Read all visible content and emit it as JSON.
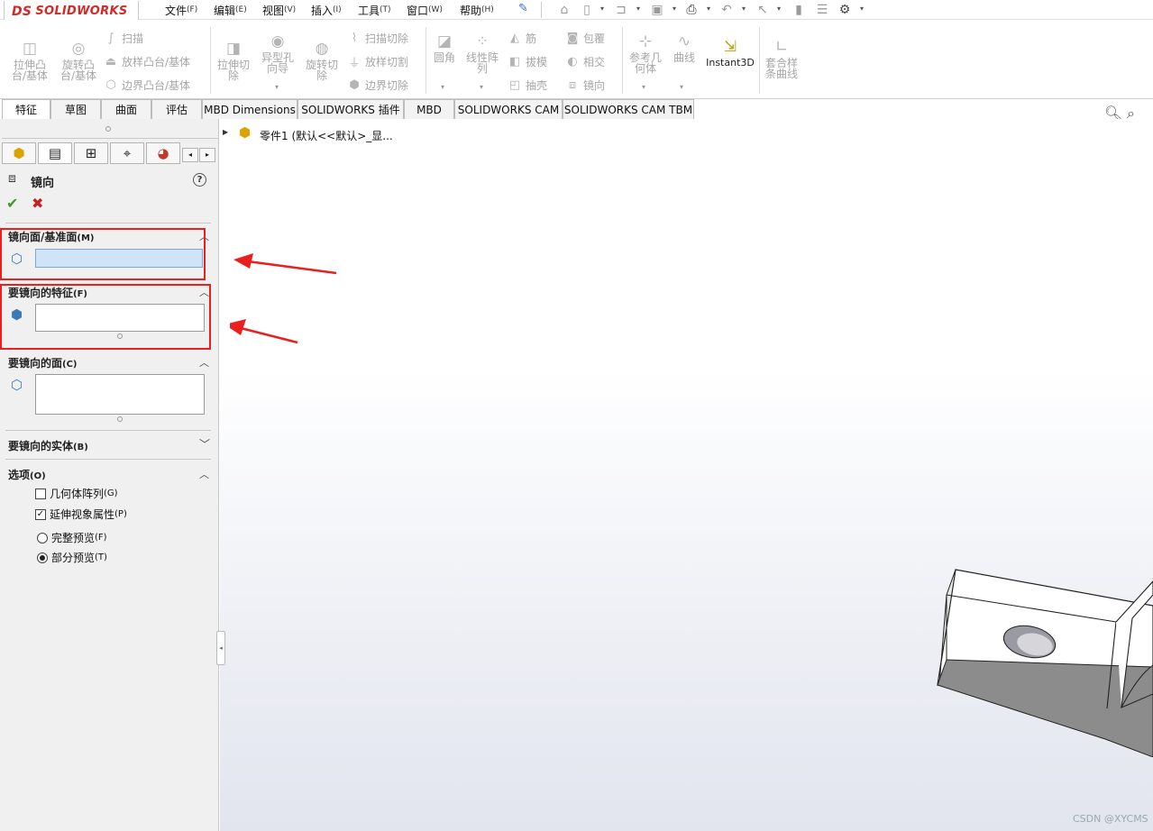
{
  "app": {
    "logo_ds": "DS",
    "logo_text": "SOLIDWORKS"
  },
  "menus": [
    {
      "label": "文件",
      "key": "(F)"
    },
    {
      "label": "编辑",
      "key": "(E)"
    },
    {
      "label": "视图",
      "key": "(V)"
    },
    {
      "label": "插入",
      "key": "(I)"
    },
    {
      "label": "工具",
      "key": "(T)"
    },
    {
      "label": "窗口",
      "key": "(W)"
    },
    {
      "label": "帮助",
      "key": "(H)"
    }
  ],
  "ribbon": {
    "extrude_boss": "拉伸凸\n台/基体",
    "revolve_boss": "旋转凸\n台/基体",
    "sweep": "扫描",
    "loft_boss": "放样凸台/基体",
    "boundary_boss": "边界凸台/基体",
    "extrude_cut": "拉伸切\n除",
    "hole_wizard": "异型孔\n向导",
    "revolve_cut": "旋转切\n除",
    "sweep_cut": "扫描切除",
    "loft_cut": "放样切割",
    "boundary_cut": "边界切除",
    "fillet": "圆角",
    "linear_pattern": "线性阵\n列",
    "rib": "筋",
    "draft": "拔模",
    "shell": "抽壳",
    "wrap": "包覆",
    "intersect": "相交",
    "mirror": "镜向",
    "ref_geometry": "参考几\n何体",
    "curves": "曲线",
    "instant3d": "Instant3D",
    "fit_spline": "套合样\n条曲线"
  },
  "tabs": [
    "特征",
    "草图",
    "曲面",
    "评估",
    "MBD Dimensions",
    "SOLIDWORKS 插件",
    "MBD",
    "SOLIDWORKS CAM",
    "SOLIDWORKS CAM TBM"
  ],
  "feature_tree": {
    "root": "零件1 (默认<<默认>_显..."
  },
  "property_manager": {
    "title": "镜向",
    "help": "?",
    "sections": {
      "mirror_plane": {
        "label": "镜向面/基准面",
        "key": "(M)"
      },
      "features": {
        "label": "要镜向的特征",
        "key": "(F)"
      },
      "faces": {
        "label": "要镜向的面",
        "key": "(C)"
      },
      "bodies": {
        "label": "要镜向的实体",
        "key": "(B)"
      },
      "options": {
        "label": "选项",
        "key": "(O)"
      }
    },
    "options": {
      "geometry_pattern": {
        "label": "几何体阵列",
        "key": "(G)",
        "checked": false
      },
      "propagate_visual": {
        "label": "延伸视象属性",
        "key": "(P)",
        "checked": true
      },
      "full_preview": {
        "label": "完整预览",
        "key": "(F)",
        "selected": false
      },
      "partial_preview": {
        "label": "部分预览",
        "key": "(T)",
        "selected": true
      }
    }
  },
  "watermark": "CSDN @XYCMS",
  "colors": {
    "brand": "#d22a27",
    "annotation_red": "#e82020",
    "selected_field": "#cfe4f7",
    "ok_green": "#3a9a2a",
    "cancel_red": "#c42020"
  }
}
